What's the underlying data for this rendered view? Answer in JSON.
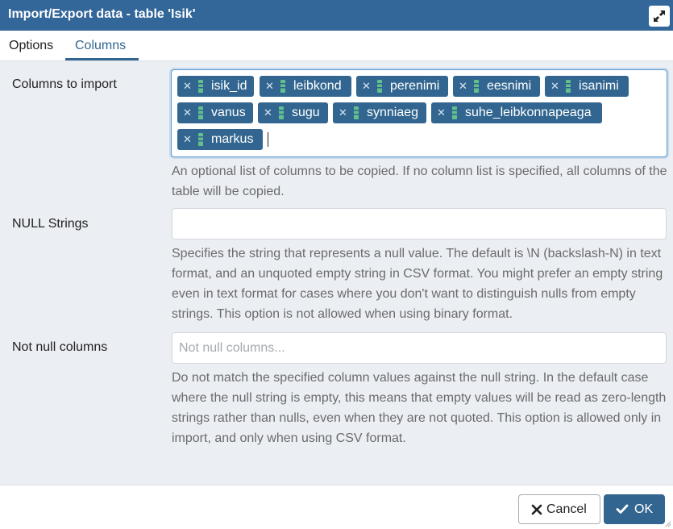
{
  "window": {
    "title": "Import/Export data - table 'Isik'",
    "maximize_icon": "expand-icon"
  },
  "tabs": [
    {
      "label": "Options",
      "active": false
    },
    {
      "label": "Columns",
      "active": true
    }
  ],
  "columns_to_import": {
    "label": "Columns to import",
    "tags": [
      "isik_id",
      "leibkond",
      "perenimi",
      "eesnimi",
      "isanimi",
      "vanus",
      "sugu",
      "synniaeg",
      "suhe_leibkonnapeaga",
      "markus"
    ],
    "help": "An optional list of columns to be copied. If no column list is specified, all columns of the table will be copied."
  },
  "null_strings": {
    "label": "NULL Strings",
    "value": "",
    "help": "Specifies the string that represents a null value. The default is \\N (backslash-N) in text format, and an unquoted empty string in CSV format. You might prefer an empty string even in text format for cases where you don't want to distinguish nulls from empty strings. This option is not allowed when using binary format."
  },
  "not_null_columns": {
    "label": "Not null columns",
    "placeholder": "Not null columns...",
    "help": "Do not match the specified column values against the null string. In the default case where the null string is empty, this means that empty values will be read as zero-length strings rather than nulls, even when they are not quoted. This option is allowed only in import, and only when using CSV format."
  },
  "footer": {
    "cancel_label": "Cancel",
    "ok_label": "OK"
  },
  "colors": {
    "accent": "#326690",
    "titlebar": "#336699",
    "panel_bg": "#ebeef3",
    "help_text": "#6b6b6b"
  }
}
